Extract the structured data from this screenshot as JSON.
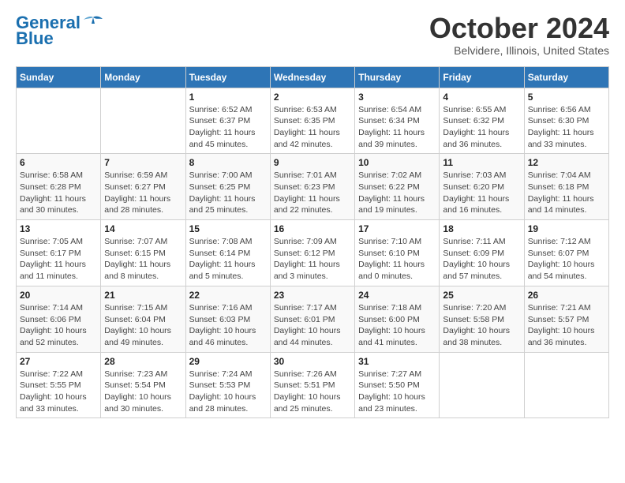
{
  "header": {
    "logo_line1": "General",
    "logo_line2": "Blue",
    "main_title": "October 2024",
    "subtitle": "Belvidere, Illinois, United States"
  },
  "days_of_week": [
    "Sunday",
    "Monday",
    "Tuesday",
    "Wednesday",
    "Thursday",
    "Friday",
    "Saturday"
  ],
  "weeks": [
    [
      {
        "day": "",
        "detail": ""
      },
      {
        "day": "",
        "detail": ""
      },
      {
        "day": "1",
        "detail": "Sunrise: 6:52 AM\nSunset: 6:37 PM\nDaylight: 11 hours\nand 45 minutes."
      },
      {
        "day": "2",
        "detail": "Sunrise: 6:53 AM\nSunset: 6:35 PM\nDaylight: 11 hours\nand 42 minutes."
      },
      {
        "day": "3",
        "detail": "Sunrise: 6:54 AM\nSunset: 6:34 PM\nDaylight: 11 hours\nand 39 minutes."
      },
      {
        "day": "4",
        "detail": "Sunrise: 6:55 AM\nSunset: 6:32 PM\nDaylight: 11 hours\nand 36 minutes."
      },
      {
        "day": "5",
        "detail": "Sunrise: 6:56 AM\nSunset: 6:30 PM\nDaylight: 11 hours\nand 33 minutes."
      }
    ],
    [
      {
        "day": "6",
        "detail": "Sunrise: 6:58 AM\nSunset: 6:28 PM\nDaylight: 11 hours\nand 30 minutes."
      },
      {
        "day": "7",
        "detail": "Sunrise: 6:59 AM\nSunset: 6:27 PM\nDaylight: 11 hours\nand 28 minutes."
      },
      {
        "day": "8",
        "detail": "Sunrise: 7:00 AM\nSunset: 6:25 PM\nDaylight: 11 hours\nand 25 minutes."
      },
      {
        "day": "9",
        "detail": "Sunrise: 7:01 AM\nSunset: 6:23 PM\nDaylight: 11 hours\nand 22 minutes."
      },
      {
        "day": "10",
        "detail": "Sunrise: 7:02 AM\nSunset: 6:22 PM\nDaylight: 11 hours\nand 19 minutes."
      },
      {
        "day": "11",
        "detail": "Sunrise: 7:03 AM\nSunset: 6:20 PM\nDaylight: 11 hours\nand 16 minutes."
      },
      {
        "day": "12",
        "detail": "Sunrise: 7:04 AM\nSunset: 6:18 PM\nDaylight: 11 hours\nand 14 minutes."
      }
    ],
    [
      {
        "day": "13",
        "detail": "Sunrise: 7:05 AM\nSunset: 6:17 PM\nDaylight: 11 hours\nand 11 minutes."
      },
      {
        "day": "14",
        "detail": "Sunrise: 7:07 AM\nSunset: 6:15 PM\nDaylight: 11 hours\nand 8 minutes."
      },
      {
        "day": "15",
        "detail": "Sunrise: 7:08 AM\nSunset: 6:14 PM\nDaylight: 11 hours\nand 5 minutes."
      },
      {
        "day": "16",
        "detail": "Sunrise: 7:09 AM\nSunset: 6:12 PM\nDaylight: 11 hours\nand 3 minutes."
      },
      {
        "day": "17",
        "detail": "Sunrise: 7:10 AM\nSunset: 6:10 PM\nDaylight: 11 hours\nand 0 minutes."
      },
      {
        "day": "18",
        "detail": "Sunrise: 7:11 AM\nSunset: 6:09 PM\nDaylight: 10 hours\nand 57 minutes."
      },
      {
        "day": "19",
        "detail": "Sunrise: 7:12 AM\nSunset: 6:07 PM\nDaylight: 10 hours\nand 54 minutes."
      }
    ],
    [
      {
        "day": "20",
        "detail": "Sunrise: 7:14 AM\nSunset: 6:06 PM\nDaylight: 10 hours\nand 52 minutes."
      },
      {
        "day": "21",
        "detail": "Sunrise: 7:15 AM\nSunset: 6:04 PM\nDaylight: 10 hours\nand 49 minutes."
      },
      {
        "day": "22",
        "detail": "Sunrise: 7:16 AM\nSunset: 6:03 PM\nDaylight: 10 hours\nand 46 minutes."
      },
      {
        "day": "23",
        "detail": "Sunrise: 7:17 AM\nSunset: 6:01 PM\nDaylight: 10 hours\nand 44 minutes."
      },
      {
        "day": "24",
        "detail": "Sunrise: 7:18 AM\nSunset: 6:00 PM\nDaylight: 10 hours\nand 41 minutes."
      },
      {
        "day": "25",
        "detail": "Sunrise: 7:20 AM\nSunset: 5:58 PM\nDaylight: 10 hours\nand 38 minutes."
      },
      {
        "day": "26",
        "detail": "Sunrise: 7:21 AM\nSunset: 5:57 PM\nDaylight: 10 hours\nand 36 minutes."
      }
    ],
    [
      {
        "day": "27",
        "detail": "Sunrise: 7:22 AM\nSunset: 5:55 PM\nDaylight: 10 hours\nand 33 minutes."
      },
      {
        "day": "28",
        "detail": "Sunrise: 7:23 AM\nSunset: 5:54 PM\nDaylight: 10 hours\nand 30 minutes."
      },
      {
        "day": "29",
        "detail": "Sunrise: 7:24 AM\nSunset: 5:53 PM\nDaylight: 10 hours\nand 28 minutes."
      },
      {
        "day": "30",
        "detail": "Sunrise: 7:26 AM\nSunset: 5:51 PM\nDaylight: 10 hours\nand 25 minutes."
      },
      {
        "day": "31",
        "detail": "Sunrise: 7:27 AM\nSunset: 5:50 PM\nDaylight: 10 hours\nand 23 minutes."
      },
      {
        "day": "",
        "detail": ""
      },
      {
        "day": "",
        "detail": ""
      }
    ]
  ]
}
